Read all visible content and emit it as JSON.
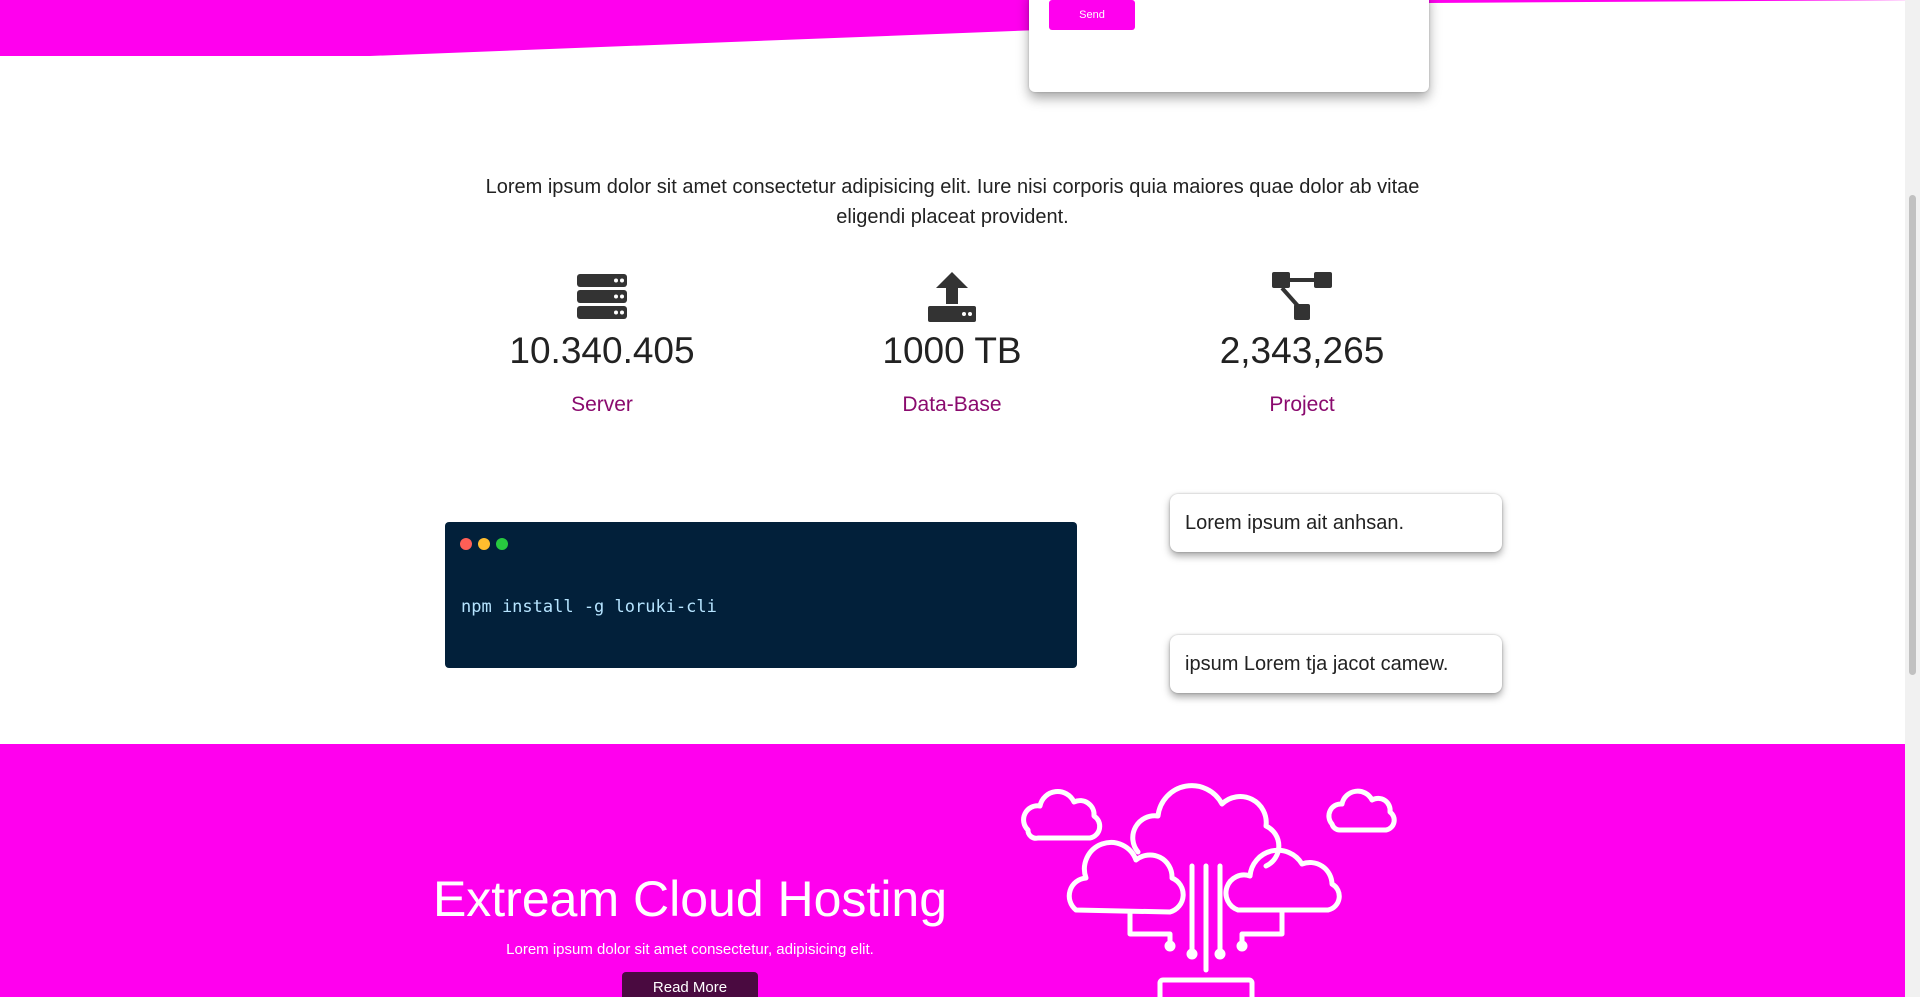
{
  "contact": {
    "send_label": "Send"
  },
  "intro": {
    "text": "Lorem ipsum dolor sit amet consectetur adipisicing elit. Iure nisi corporis quia maiores quae dolor ab vitae eligendi placeat provident."
  },
  "stats": [
    {
      "icon": "server-icon",
      "value": "10.340.405",
      "label": "Server"
    },
    {
      "icon": "upload-icon",
      "value": "1000 TB",
      "label": "Data-Base"
    },
    {
      "icon": "project-diagram-icon",
      "value": "2,343,265",
      "label": "Project"
    }
  ],
  "terminal": {
    "command": "npm install -g loruki-cli",
    "dot_colors": [
      "#ff5f56",
      "#ffbd2e",
      "#27c93f"
    ]
  },
  "notes": [
    {
      "text": "Lorem ipsum ait anhsan."
    },
    {
      "text": "ipsum Lorem tja jacot camew."
    }
  ],
  "hero": {
    "title": "Extream Cloud Hosting",
    "subtitle": "Lorem ipsum dolor sit amet consectetur, adipisicing elit.",
    "button_label": "Read More"
  },
  "colors": {
    "accent": "#ff00ee",
    "stat_label": "#8a0a6e",
    "terminal_bg": "#02203a",
    "button_dark": "#4a0a40"
  }
}
